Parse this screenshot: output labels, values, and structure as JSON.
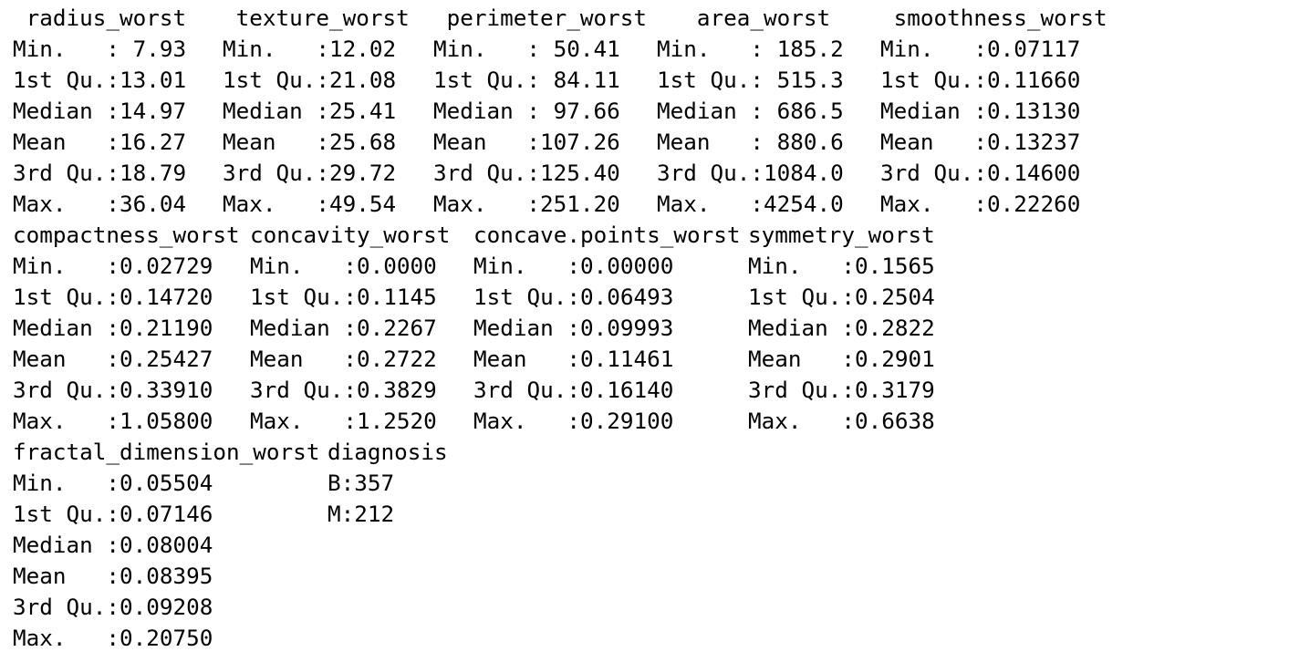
{
  "summary_blocks": [
    {
      "columns": [
        {
          "header": " radius_worst",
          "rows": [
            "Min.   : 7.93",
            "1st Qu.:13.01",
            "Median :14.97",
            "Mean   :16.27",
            "3rd Qu.:18.79",
            "Max.   :36.04"
          ]
        },
        {
          "header": " texture_worst",
          "rows": [
            "Min.   :12.02",
            "1st Qu.:21.08",
            "Median :25.41",
            "Mean   :25.68",
            "3rd Qu.:29.72",
            "Max.   :49.54"
          ]
        },
        {
          "header": " perimeter_worst",
          "rows": [
            "Min.   : 50.41",
            "1st Qu.: 84.11",
            "Median : 97.66",
            "Mean   :107.26",
            "3rd Qu.:125.40",
            "Max.   :251.20"
          ]
        },
        {
          "header": "   area_worst",
          "rows": [
            "Min.   : 185.2",
            "1st Qu.: 515.3",
            "Median : 686.5",
            "Mean   : 880.6",
            "3rd Qu.:1084.0",
            "Max.   :4254.0"
          ]
        },
        {
          "header": " smoothness_worst",
          "rows": [
            "Min.   :0.07117",
            "1st Qu.:0.11660",
            "Median :0.13130",
            "Mean   :0.13237",
            "3rd Qu.:0.14600",
            "Max.   :0.22260"
          ]
        }
      ]
    },
    {
      "columns": [
        {
          "header": "compactness_worst",
          "rows": [
            "Min.   :0.02729",
            "1st Qu.:0.14720",
            "Median :0.21190",
            "Mean   :0.25427",
            "3rd Qu.:0.33910",
            "Max.   :1.05800"
          ]
        },
        {
          "header": "concavity_worst",
          "rows": [
            "Min.   :0.0000",
            "1st Qu.:0.1145",
            "Median :0.2267",
            "Mean   :0.2722",
            "3rd Qu.:0.3829",
            "Max.   :1.2520"
          ]
        },
        {
          "header": "concave.points_worst",
          "rows": [
            "Min.   :0.00000",
            "1st Qu.:0.06493",
            "Median :0.09993",
            "Mean   :0.11461",
            "3rd Qu.:0.16140",
            "Max.   :0.29100"
          ]
        },
        {
          "header": "symmetry_worst",
          "rows": [
            "Min.   :0.1565",
            "1st Qu.:0.2504",
            "Median :0.2822",
            "Mean   :0.2901",
            "3rd Qu.:0.3179",
            "Max.   :0.6638"
          ]
        }
      ]
    },
    {
      "columns": [
        {
          "header": "fractal_dimension_worst",
          "rows": [
            "Min.   :0.05504",
            "1st Qu.:0.07146",
            "Median :0.08004",
            "Mean   :0.08395",
            "3rd Qu.:0.09208",
            "Max.   :0.20750"
          ]
        },
        {
          "header": "diagnosis",
          "rows": [
            "B:357",
            "M:212"
          ]
        }
      ]
    }
  ]
}
